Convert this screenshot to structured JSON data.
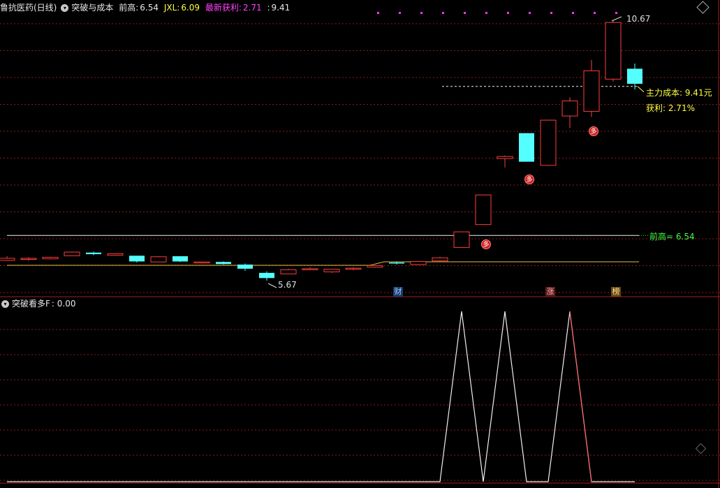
{
  "header": {
    "stock_name": "鲁抗医药(日线)",
    "indicator_name": "突破与成本",
    "qiangao_label": "前高:",
    "qiangao_value": "6.54",
    "jxl_label": "JXL:",
    "jxl_value": "6.09",
    "profit_label": "最新获利:",
    "profit_value": "2.71",
    "cost_sep": ":",
    "cost_value": "9.41"
  },
  "sub_header": {
    "indicator_name": "突破看多F",
    "value": ": 0.00"
  },
  "annotations": {
    "high_price": "10.67",
    "low_price": "5.67",
    "main_cost": "主力成本: 9.41元",
    "profit": "获利: 2.71%",
    "qiangao_line": "前高= 6.54",
    "buy_signal": "多",
    "tag_cai": "财",
    "tag_zhang": "涨",
    "tag_bang": "榜"
  },
  "colors": {
    "up": "#ff3c3c",
    "down": "#54ffff",
    "grid": "#8a1c1c",
    "profit": "#ff40ff",
    "qiangao": "#00ff00",
    "cost": "#ffff00"
  },
  "chart_data": {
    "type": "candlestick",
    "ohlc": [
      [
        6.06,
        6.14,
        6.05,
        6.1
      ],
      [
        6.08,
        6.12,
        6.05,
        6.1
      ],
      [
        6.09,
        6.13,
        6.08,
        6.12
      ],
      [
        6.15,
        6.23,
        6.14,
        6.22
      ],
      [
        6.21,
        6.23,
        6.16,
        6.18
      ],
      [
        6.16,
        6.2,
        6.15,
        6.19
      ],
      [
        6.15,
        6.15,
        6.02,
        6.04
      ],
      [
        6.03,
        6.14,
        6.03,
        6.13
      ],
      [
        6.14,
        6.14,
        6.03,
        6.04
      ],
      [
        6.01,
        6.04,
        6.0,
        6.03
      ],
      [
        6.03,
        6.04,
        5.98,
        5.99
      ],
      [
        5.98,
        6.0,
        5.86,
        5.9
      ],
      [
        5.82,
        5.85,
        5.67,
        5.72
      ],
      [
        5.8,
        5.9,
        5.8,
        5.88
      ],
      [
        5.9,
        5.93,
        5.89,
        5.9
      ],
      [
        5.84,
        5.9,
        5.82,
        5.89
      ],
      [
        5.89,
        5.93,
        5.87,
        5.91
      ],
      [
        5.93,
        5.97,
        5.92,
        5.96
      ],
      [
        6.02,
        6.04,
        5.98,
        6.0
      ],
      [
        5.98,
        6.05,
        5.97,
        6.04
      ],
      [
        6.05,
        6.13,
        6.04,
        6.11
      ],
      [
        6.31,
        6.61,
        6.31,
        6.61
      ],
      [
        6.75,
        7.32,
        6.75,
        7.32
      ],
      [
        8.02,
        8.08,
        7.85,
        8.06
      ],
      [
        8.51,
        8.51,
        7.96,
        7.96
      ],
      [
        7.89,
        8.77,
        7.88,
        8.76
      ],
      [
        8.84,
        9.2,
        8.61,
        9.13
      ],
      [
        8.93,
        9.92,
        8.82,
        9.71
      ],
      [
        9.55,
        10.67,
        9.5,
        10.64
      ],
      [
        9.75,
        9.85,
        9.35,
        9.46
      ]
    ],
    "qiangao": 6.54,
    "main_cost": 9.41,
    "low": 5.67,
    "high": 10.67,
    "buy_signal_bars": [
      22,
      24,
      28
    ],
    "sub_indicator": {
      "name": "突破看多F",
      "values": [
        0,
        0,
        0,
        0,
        0,
        0,
        0,
        0,
        0,
        0,
        0,
        0,
        0,
        0,
        0,
        0,
        0,
        0,
        0,
        0,
        0,
        1,
        0,
        1,
        0,
        0,
        1,
        0,
        0,
        0
      ]
    }
  }
}
